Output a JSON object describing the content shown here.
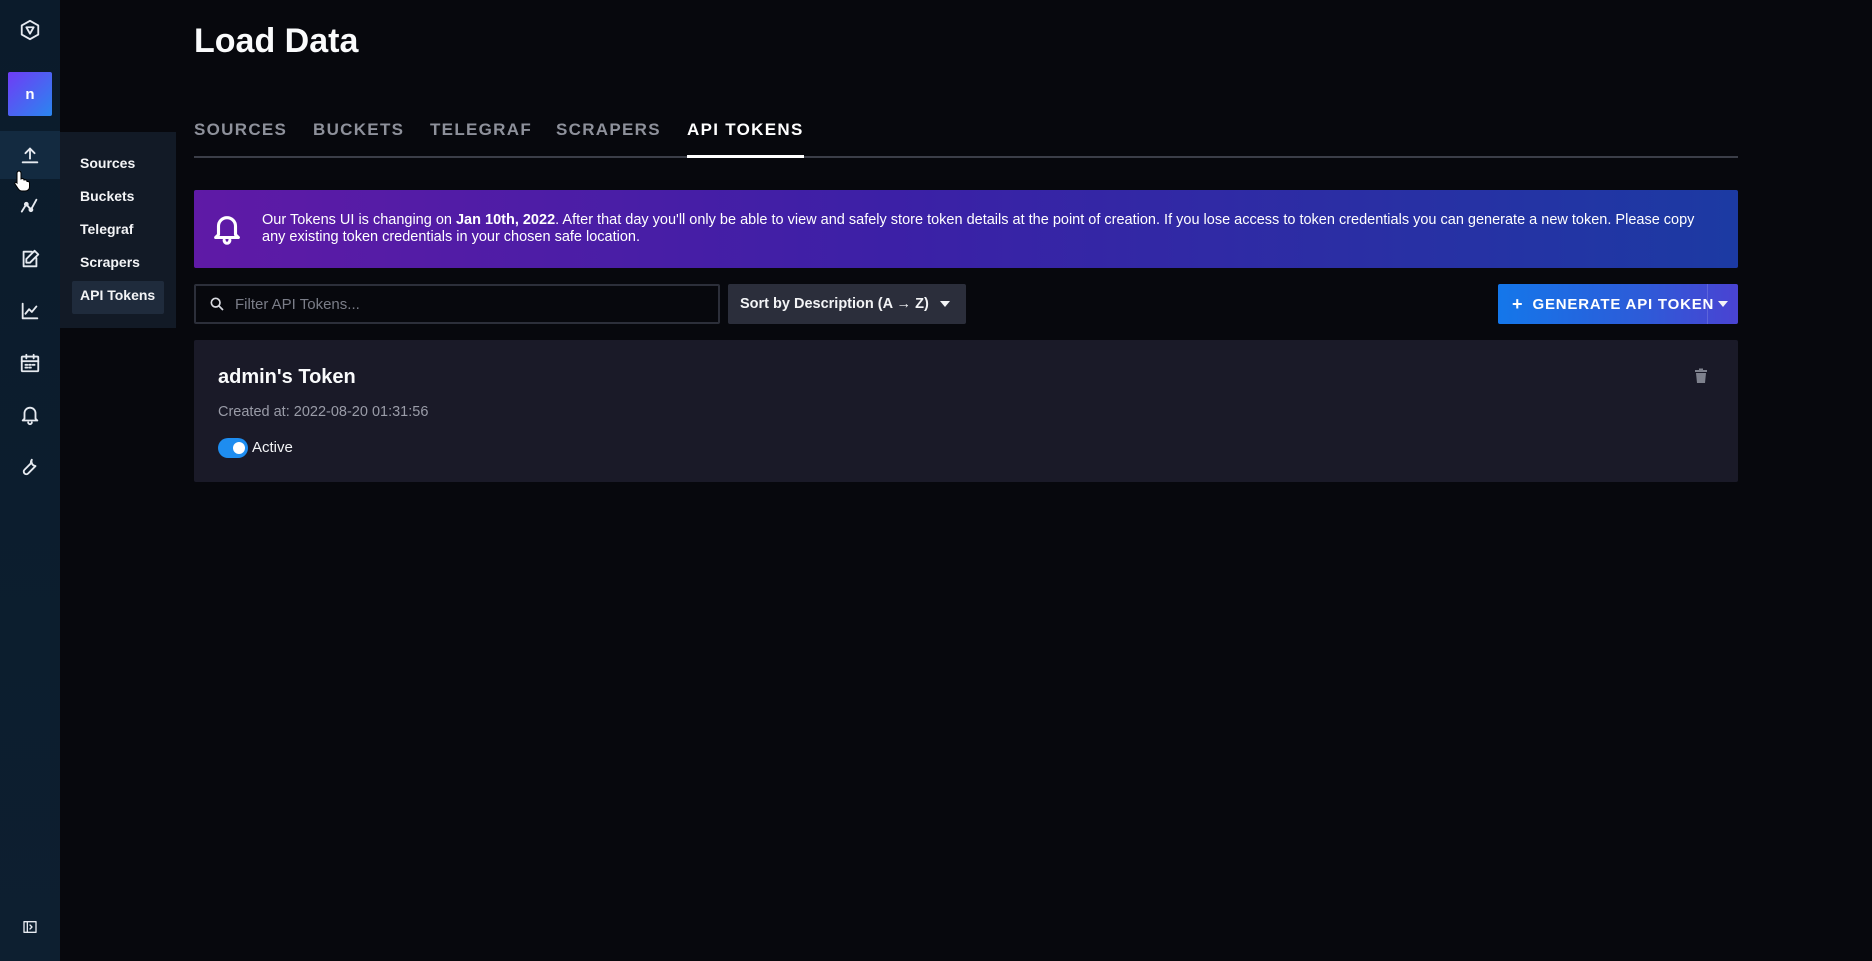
{
  "page": {
    "title": "Load Data"
  },
  "rail": {
    "org_initial": "n",
    "icons": [
      "influx-logo-icon",
      "upload-icon",
      "graph-icon",
      "notebook-icon",
      "chart-icon",
      "calendar-icon",
      "bell-icon",
      "wrench-icon",
      "collapse-icon"
    ]
  },
  "flyout": {
    "items": [
      "Sources",
      "Buckets",
      "Telegraf",
      "Scrapers",
      "API Tokens"
    ],
    "selected": "API Tokens"
  },
  "tabs": [
    {
      "label": "SOURCES",
      "active": false
    },
    {
      "label": "BUCKETS",
      "active": false
    },
    {
      "label": "TELEGRAF",
      "active": false
    },
    {
      "label": "SCRAPERS",
      "active": false
    },
    {
      "label": "API TOKENS",
      "active": true
    }
  ],
  "notice": {
    "pre": "Our Tokens UI is changing on ",
    "date": "Jan 10th, 2022",
    "post": ". After that day you'll only be able to view and safely store token details at the point of creation. If you lose access to token credentials you can generate a new token. Please copy any existing token credentials in your chosen safe location."
  },
  "filter": {
    "placeholder": "Filter API Tokens...",
    "value": ""
  },
  "sort": {
    "label": "Sort by Description (A → Z)"
  },
  "generate": {
    "label": "GENERATE API TOKEN"
  },
  "tokens": [
    {
      "name": "admin's Token",
      "created": "Created at: 2022-08-20 01:31:56",
      "status": "Active",
      "active": true
    }
  ],
  "colors": {
    "accent": "#1e8df0",
    "background": "#07080d",
    "card": "#1a1a28"
  }
}
